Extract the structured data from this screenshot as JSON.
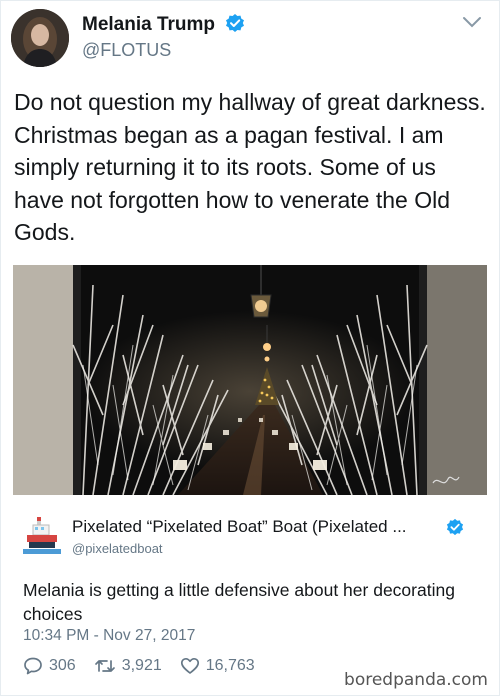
{
  "tweet": {
    "author_name": "Melania Trump",
    "author_handle": "@FLOTUS",
    "text": "Do not question my hallway of great darkness. Christmas began as a pagan festival. I am simply returning it to its roots. Some of us have not forgotten how to venerate the Old Gods.",
    "icons": {
      "verified": "verified-badge-icon",
      "menu": "chevron-down-icon"
    }
  },
  "reply": {
    "author_name": "Pixelated “Pixelated Boat” Boat (Pixelated ...",
    "author_handle": "@pixelatedboat",
    "text": "Melania is getting a little defensive about her decorating choices",
    "timestamp": "10:34 PM - Nov 27, 2017",
    "stats": {
      "replies": "306",
      "retweets": "3,921",
      "likes": "16,763"
    }
  },
  "watermark": "boredpanda.com",
  "colors": {
    "verified": "#1da1f2",
    "muted": "#657786",
    "text": "#14171a"
  }
}
